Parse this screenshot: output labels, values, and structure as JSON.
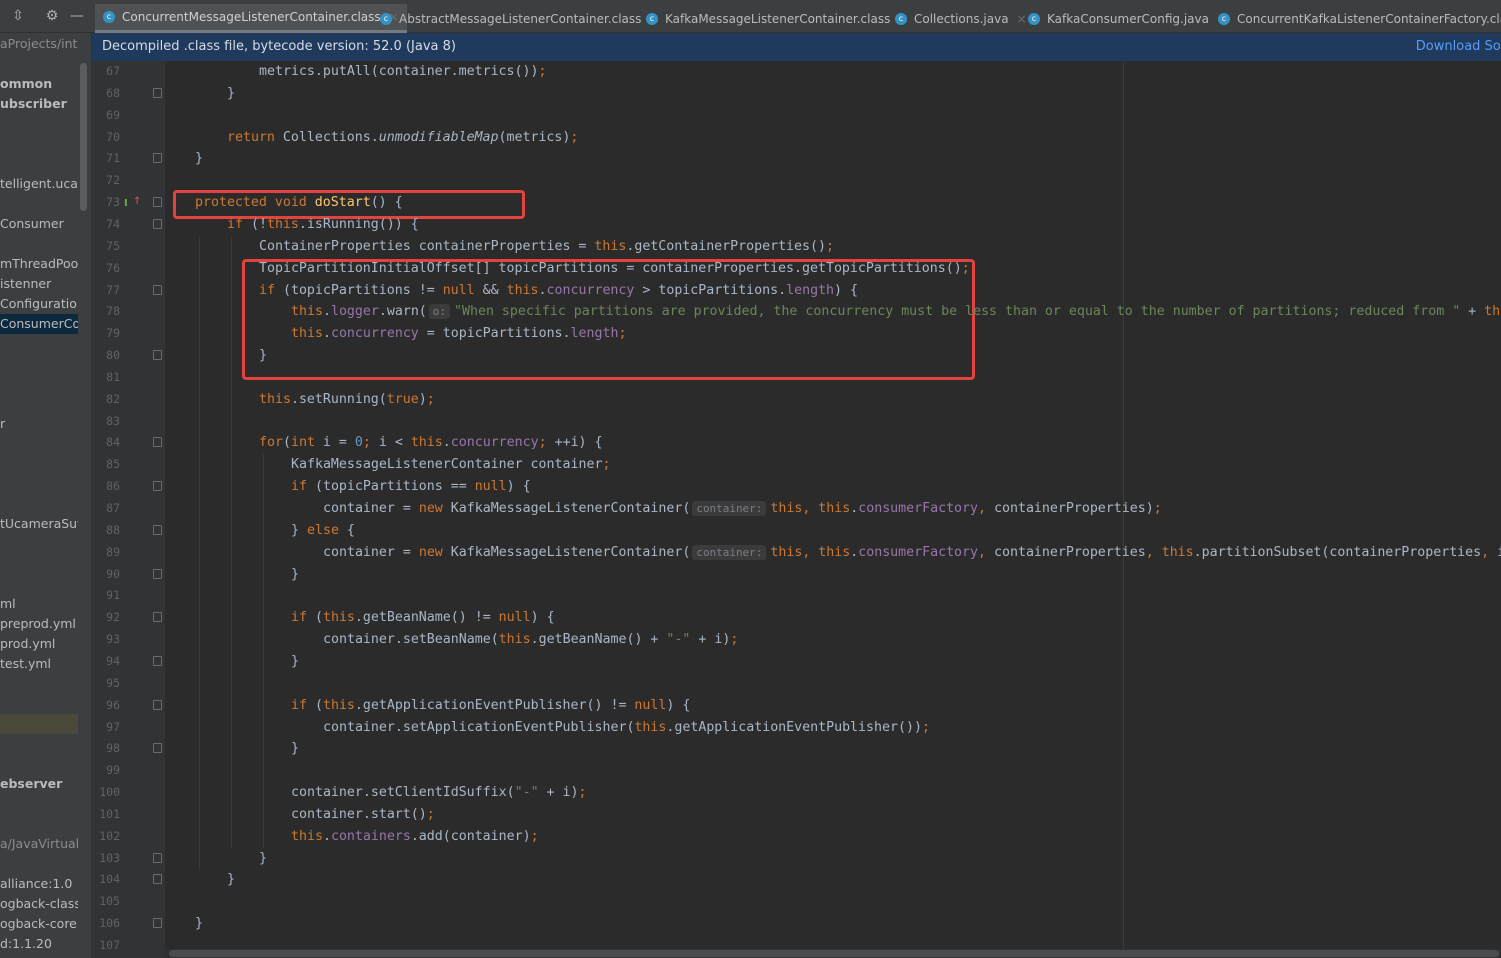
{
  "topbar": {
    "icons": [
      "expand-collapse-icon",
      "gear-icon",
      "minimize-icon"
    ],
    "tabs": [
      {
        "label": "ConcurrentMessageListenerContainer.class",
        "active": true,
        "icon": "class-icon"
      },
      {
        "label": "AbstractMessageListenerContainer.class",
        "active": false,
        "icon": "abstract-class-icon"
      },
      {
        "label": "KafkaMessageListenerContainer.class",
        "active": false,
        "icon": "class-icon"
      },
      {
        "label": "Collections.java",
        "active": false,
        "icon": "class-icon"
      },
      {
        "label": "KafkaConsumerConfig.java",
        "active": false,
        "icon": "class-icon"
      },
      {
        "label": "ConcurrentKafkaListenerContainerFactory.class",
        "active": false,
        "icon": "class-icon"
      }
    ]
  },
  "banner": {
    "text": "Decompiled .class file, bytecode version: 52.0 (Java 8)",
    "link": "Download Sou"
  },
  "sidebar": {
    "items": [
      {
        "label": "aProjects/inte",
        "style": "dim"
      },
      {
        "label": "ommon",
        "style": "bold"
      },
      {
        "label": "ubscriber",
        "style": "bold"
      },
      {
        "label": "telligent.ucar",
        "style": ""
      },
      {
        "label": "Consumer",
        "style": ""
      },
      {
        "label": "mThreadPool'",
        "style": ""
      },
      {
        "label": "istenner",
        "style": ""
      },
      {
        "label": "Configuration",
        "style": ""
      },
      {
        "label": "ConsumerCor",
        "style": "sel"
      },
      {
        "label": "r",
        "style": ""
      },
      {
        "label": "tUcameraSut",
        "style": ""
      },
      {
        "label": "ml",
        "style": ""
      },
      {
        "label": "preprod.yml",
        "style": ""
      },
      {
        "label": "prod.yml",
        "style": ""
      },
      {
        "label": "test.yml",
        "style": ""
      },
      {
        "label": "",
        "style": "olive"
      },
      {
        "label": "ebserver",
        "style": "bold"
      },
      {
        "label": "a/JavaVirtual",
        "style": "dim"
      },
      {
        "label": "alliance:1.0",
        "style": ""
      },
      {
        "label": "ogback-class",
        "style": ""
      },
      {
        "label": "ogback-core",
        "style": ""
      },
      {
        "label": "d:1.1.20",
        "style": ""
      }
    ]
  },
  "colors": {
    "keyword": "#cc7832",
    "field": "#9876aa",
    "string": "#6a8759",
    "method": "#ffc66d",
    "number": "#6897bb",
    "text": "#a9b7c6",
    "highlight_box": "#e3433f"
  },
  "code": {
    "lines": [
      {
        "n": "67",
        "indent": 12,
        "tokens": [
          [
            "p",
            "metrics.putAll(container.metrics())"
          ],
          [
            "k",
            ";"
          ]
        ]
      },
      {
        "n": "68",
        "indent": 8,
        "fold": true,
        "tokens": [
          [
            "p",
            "}"
          ]
        ]
      },
      {
        "n": "69",
        "indent": 0,
        "tokens": []
      },
      {
        "n": "70",
        "indent": 8,
        "tokens": [
          [
            "k",
            "return "
          ],
          [
            "p",
            "Collections."
          ],
          [
            "i",
            "unmodifiableMap"
          ],
          [
            "p",
            "(metrics)"
          ],
          [
            "k",
            ";"
          ]
        ]
      },
      {
        "n": "71",
        "indent": 4,
        "fold": true,
        "tokens": [
          [
            "p",
            "}"
          ]
        ]
      },
      {
        "n": "72",
        "indent": 0,
        "tokens": []
      },
      {
        "n": "73",
        "indent": 4,
        "fold": true,
        "override": true,
        "tokens": [
          [
            "k",
            "protected void "
          ],
          [
            "m",
            "doStart"
          ],
          [
            "p",
            "() {"
          ]
        ]
      },
      {
        "n": "74",
        "indent": 8,
        "fold": true,
        "tokens": [
          [
            "k",
            "if "
          ],
          [
            "p",
            "(!"
          ],
          [
            "k",
            "this"
          ],
          [
            "p",
            ".isRunning()) {"
          ]
        ]
      },
      {
        "n": "75",
        "indent": 12,
        "tokens": [
          [
            "p",
            "ContainerProperties containerProperties = "
          ],
          [
            "k",
            "this"
          ],
          [
            "p",
            ".getContainerProperties()"
          ],
          [
            "k",
            ";"
          ]
        ]
      },
      {
        "n": "76",
        "indent": 12,
        "tokens": [
          [
            "p",
            "TopicPartitionInitialOffset[] topicPartitions = containerProperties.getTopicPartitions()"
          ],
          [
            "k",
            ";"
          ]
        ]
      },
      {
        "n": "77",
        "indent": 12,
        "fold": true,
        "tokens": [
          [
            "k",
            "if "
          ],
          [
            "p",
            "(topicPartitions != "
          ],
          [
            "k",
            "null "
          ],
          [
            "p",
            "&& "
          ],
          [
            "k",
            "this"
          ],
          [
            "p",
            "."
          ],
          [
            "f",
            "concurrency"
          ],
          [
            "p",
            " > topicPartitions."
          ],
          [
            "f",
            "length"
          ],
          [
            "p",
            ") {"
          ]
        ]
      },
      {
        "n": "78",
        "indent": 16,
        "tokens": [
          [
            "k",
            "this"
          ],
          [
            "p",
            "."
          ],
          [
            "f",
            "logger"
          ],
          [
            "p",
            ".warn("
          ],
          [
            "h",
            "o:"
          ],
          [
            "s",
            "\"When specific partitions are provided, the concurrency must be less than or equal to the number of partitions; reduced from \""
          ],
          [
            "p",
            " + "
          ],
          [
            "k",
            "th"
          ]
        ]
      },
      {
        "n": "79",
        "indent": 16,
        "tokens": [
          [
            "k",
            "this"
          ],
          [
            "p",
            "."
          ],
          [
            "f",
            "concurrency"
          ],
          [
            "p",
            " = topicPartitions."
          ],
          [
            "f",
            "length"
          ],
          [
            "k",
            ";"
          ]
        ]
      },
      {
        "n": "80",
        "indent": 12,
        "fold": true,
        "tokens": [
          [
            "p",
            "}"
          ]
        ]
      },
      {
        "n": "81",
        "indent": 0,
        "tokens": []
      },
      {
        "n": "82",
        "indent": 12,
        "tokens": [
          [
            "k",
            "this"
          ],
          [
            "p",
            ".setRunning("
          ],
          [
            "k",
            "true"
          ],
          [
            "p",
            ")"
          ],
          [
            "k",
            ";"
          ]
        ]
      },
      {
        "n": "83",
        "indent": 0,
        "tokens": []
      },
      {
        "n": "84",
        "indent": 12,
        "fold": true,
        "tokens": [
          [
            "k",
            "for"
          ],
          [
            "p",
            "("
          ],
          [
            "k",
            "int "
          ],
          [
            "p",
            "i = "
          ],
          [
            "n",
            "0"
          ],
          [
            "k",
            "; "
          ],
          [
            "p",
            "i < "
          ],
          [
            "k",
            "this"
          ],
          [
            "p",
            "."
          ],
          [
            "f",
            "concurrency"
          ],
          [
            "k",
            "; "
          ],
          [
            "p",
            "++i) {"
          ]
        ]
      },
      {
        "n": "85",
        "indent": 16,
        "tokens": [
          [
            "p",
            "KafkaMessageListenerContainer container"
          ],
          [
            "k",
            ";"
          ]
        ]
      },
      {
        "n": "86",
        "indent": 16,
        "fold": true,
        "tokens": [
          [
            "k",
            "if "
          ],
          [
            "p",
            "(topicPartitions == "
          ],
          [
            "k",
            "null"
          ],
          [
            "p",
            ") {"
          ]
        ]
      },
      {
        "n": "87",
        "indent": 20,
        "tokens": [
          [
            "p",
            "container = "
          ],
          [
            "k",
            "new "
          ],
          [
            "p",
            "KafkaMessageListenerContainer("
          ],
          [
            "h",
            "container:"
          ],
          [
            "k",
            "this, this"
          ],
          [
            "p",
            "."
          ],
          [
            "f",
            "consumerFactory"
          ],
          [
            "k",
            ", "
          ],
          [
            "p",
            "containerProperties)"
          ],
          [
            "k",
            ";"
          ]
        ]
      },
      {
        "n": "88",
        "indent": 16,
        "fold": true,
        "tokens": [
          [
            "p",
            "} "
          ],
          [
            "k",
            "else "
          ],
          [
            "p",
            "{"
          ]
        ]
      },
      {
        "n": "89",
        "indent": 20,
        "tokens": [
          [
            "p",
            "container = "
          ],
          [
            "k",
            "new "
          ],
          [
            "p",
            "KafkaMessageListenerContainer("
          ],
          [
            "h",
            "container:"
          ],
          [
            "k",
            "this, this"
          ],
          [
            "p",
            "."
          ],
          [
            "f",
            "consumerFactory"
          ],
          [
            "k",
            ", "
          ],
          [
            "p",
            "containerProperties"
          ],
          [
            "k",
            ", this"
          ],
          [
            "p",
            ".partitionSubset(containerProperties"
          ],
          [
            "k",
            ", "
          ],
          [
            "p",
            "i)"
          ]
        ]
      },
      {
        "n": "90",
        "indent": 16,
        "fold": true,
        "tokens": [
          [
            "p",
            "}"
          ]
        ]
      },
      {
        "n": "91",
        "indent": 0,
        "tokens": []
      },
      {
        "n": "92",
        "indent": 16,
        "fold": true,
        "tokens": [
          [
            "k",
            "if "
          ],
          [
            "p",
            "("
          ],
          [
            "k",
            "this"
          ],
          [
            "p",
            ".getBeanName() != "
          ],
          [
            "k",
            "null"
          ],
          [
            "p",
            ") {"
          ]
        ]
      },
      {
        "n": "93",
        "indent": 20,
        "tokens": [
          [
            "p",
            "container.setBeanName("
          ],
          [
            "k",
            "this"
          ],
          [
            "p",
            ".getBeanName() + "
          ],
          [
            "s",
            "\"-\""
          ],
          [
            "p",
            " + i)"
          ],
          [
            "k",
            ";"
          ]
        ]
      },
      {
        "n": "94",
        "indent": 16,
        "fold": true,
        "tokens": [
          [
            "p",
            "}"
          ]
        ]
      },
      {
        "n": "95",
        "indent": 0,
        "tokens": []
      },
      {
        "n": "96",
        "indent": 16,
        "fold": true,
        "tokens": [
          [
            "k",
            "if "
          ],
          [
            "p",
            "("
          ],
          [
            "k",
            "this"
          ],
          [
            "p",
            ".getApplicationEventPublisher() != "
          ],
          [
            "k",
            "null"
          ],
          [
            "p",
            ") {"
          ]
        ]
      },
      {
        "n": "97",
        "indent": 20,
        "tokens": [
          [
            "p",
            "container.setApplicationEventPublisher("
          ],
          [
            "k",
            "this"
          ],
          [
            "p",
            ".getApplicationEventPublisher())"
          ],
          [
            "k",
            ";"
          ]
        ]
      },
      {
        "n": "98",
        "indent": 16,
        "fold": true,
        "tokens": [
          [
            "p",
            "}"
          ]
        ]
      },
      {
        "n": "99",
        "indent": 0,
        "tokens": []
      },
      {
        "n": "100",
        "indent": 16,
        "tokens": [
          [
            "p",
            "container.setClientIdSuffix("
          ],
          [
            "s",
            "\"-\""
          ],
          [
            "p",
            " + i)"
          ],
          [
            "k",
            ";"
          ]
        ]
      },
      {
        "n": "101",
        "indent": 16,
        "tokens": [
          [
            "p",
            "container.start()"
          ],
          [
            "k",
            ";"
          ]
        ]
      },
      {
        "n": "102",
        "indent": 16,
        "tokens": [
          [
            "k",
            "this"
          ],
          [
            "p",
            "."
          ],
          [
            "f",
            "containers"
          ],
          [
            "p",
            ".add(container)"
          ],
          [
            "k",
            ";"
          ]
        ]
      },
      {
        "n": "103",
        "indent": 12,
        "fold": true,
        "tokens": [
          [
            "p",
            "}"
          ]
        ]
      },
      {
        "n": "104",
        "indent": 8,
        "fold": true,
        "tokens": [
          [
            "p",
            "}"
          ]
        ]
      },
      {
        "n": "105",
        "indent": 0,
        "tokens": []
      },
      {
        "n": "106",
        "indent": 4,
        "fold": true,
        "tokens": [
          [
            "p",
            "}"
          ]
        ]
      },
      {
        "n": "107",
        "indent": 0,
        "tokens": []
      }
    ]
  }
}
